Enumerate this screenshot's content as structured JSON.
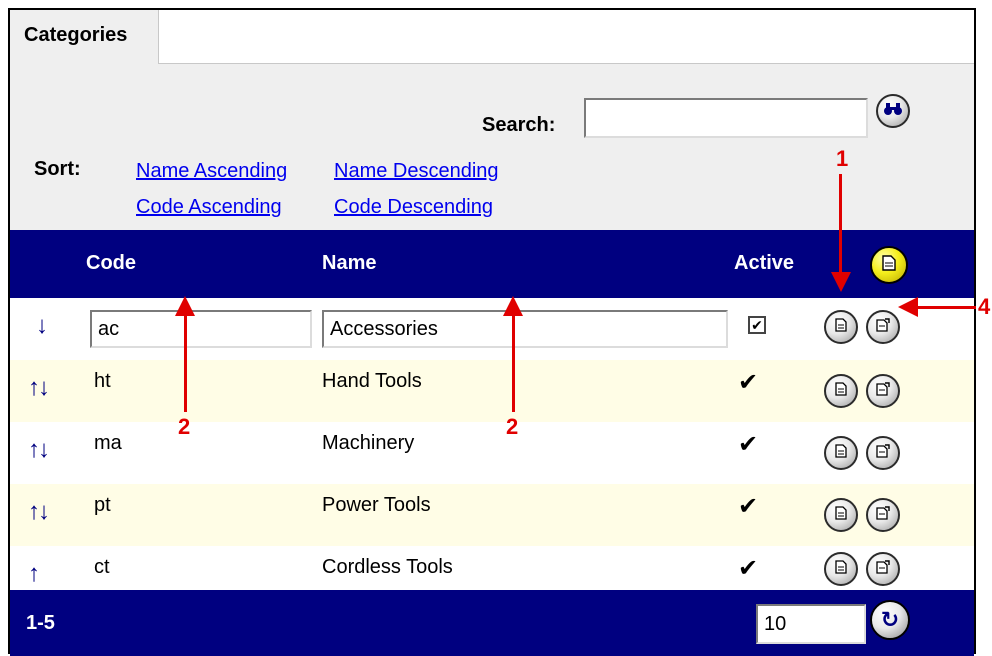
{
  "tab": {
    "label": "Categories"
  },
  "search": {
    "label": "Search:",
    "value": "",
    "button_icon": "binoculars-icon"
  },
  "sort": {
    "label": "Sort:",
    "links": [
      "Name Ascending",
      "Name Descending",
      "Code Ascending",
      "Code Descending"
    ]
  },
  "table": {
    "headers": {
      "code": "Code",
      "name": "Name",
      "active": "Active"
    },
    "add_icon": "new-document-icon",
    "edit_row": {
      "arrows": "↓",
      "code": "ac",
      "name": "Accessories",
      "active_mark": "✔"
    },
    "rows": [
      {
        "arrows": "↑↓",
        "code": "ht",
        "name": "Hand Tools",
        "active_mark": "✔"
      },
      {
        "arrows": "↑↓",
        "code": "ma",
        "name": "Machinery",
        "active_mark": "✔"
      },
      {
        "arrows": "↑↓",
        "code": "pt",
        "name": "Power Tools",
        "active_mark": "✔"
      },
      {
        "arrows": "↑",
        "code": "ct",
        "name": "Cordless Tools",
        "active_mark": "✔"
      }
    ],
    "row_icons": {
      "edit": "document-icon",
      "detail": "document-arrow-icon"
    }
  },
  "footer": {
    "range": "1-5",
    "page_size": "10",
    "refresh_icon": "refresh-icon"
  },
  "callouts": {
    "c1": "1",
    "c2a": "2",
    "c2b": "2",
    "c4": "4"
  },
  "colors": {
    "header_bg": "#000080",
    "odd_row": "#fffde6",
    "callout": "#e00000",
    "link": "#0000ee"
  }
}
